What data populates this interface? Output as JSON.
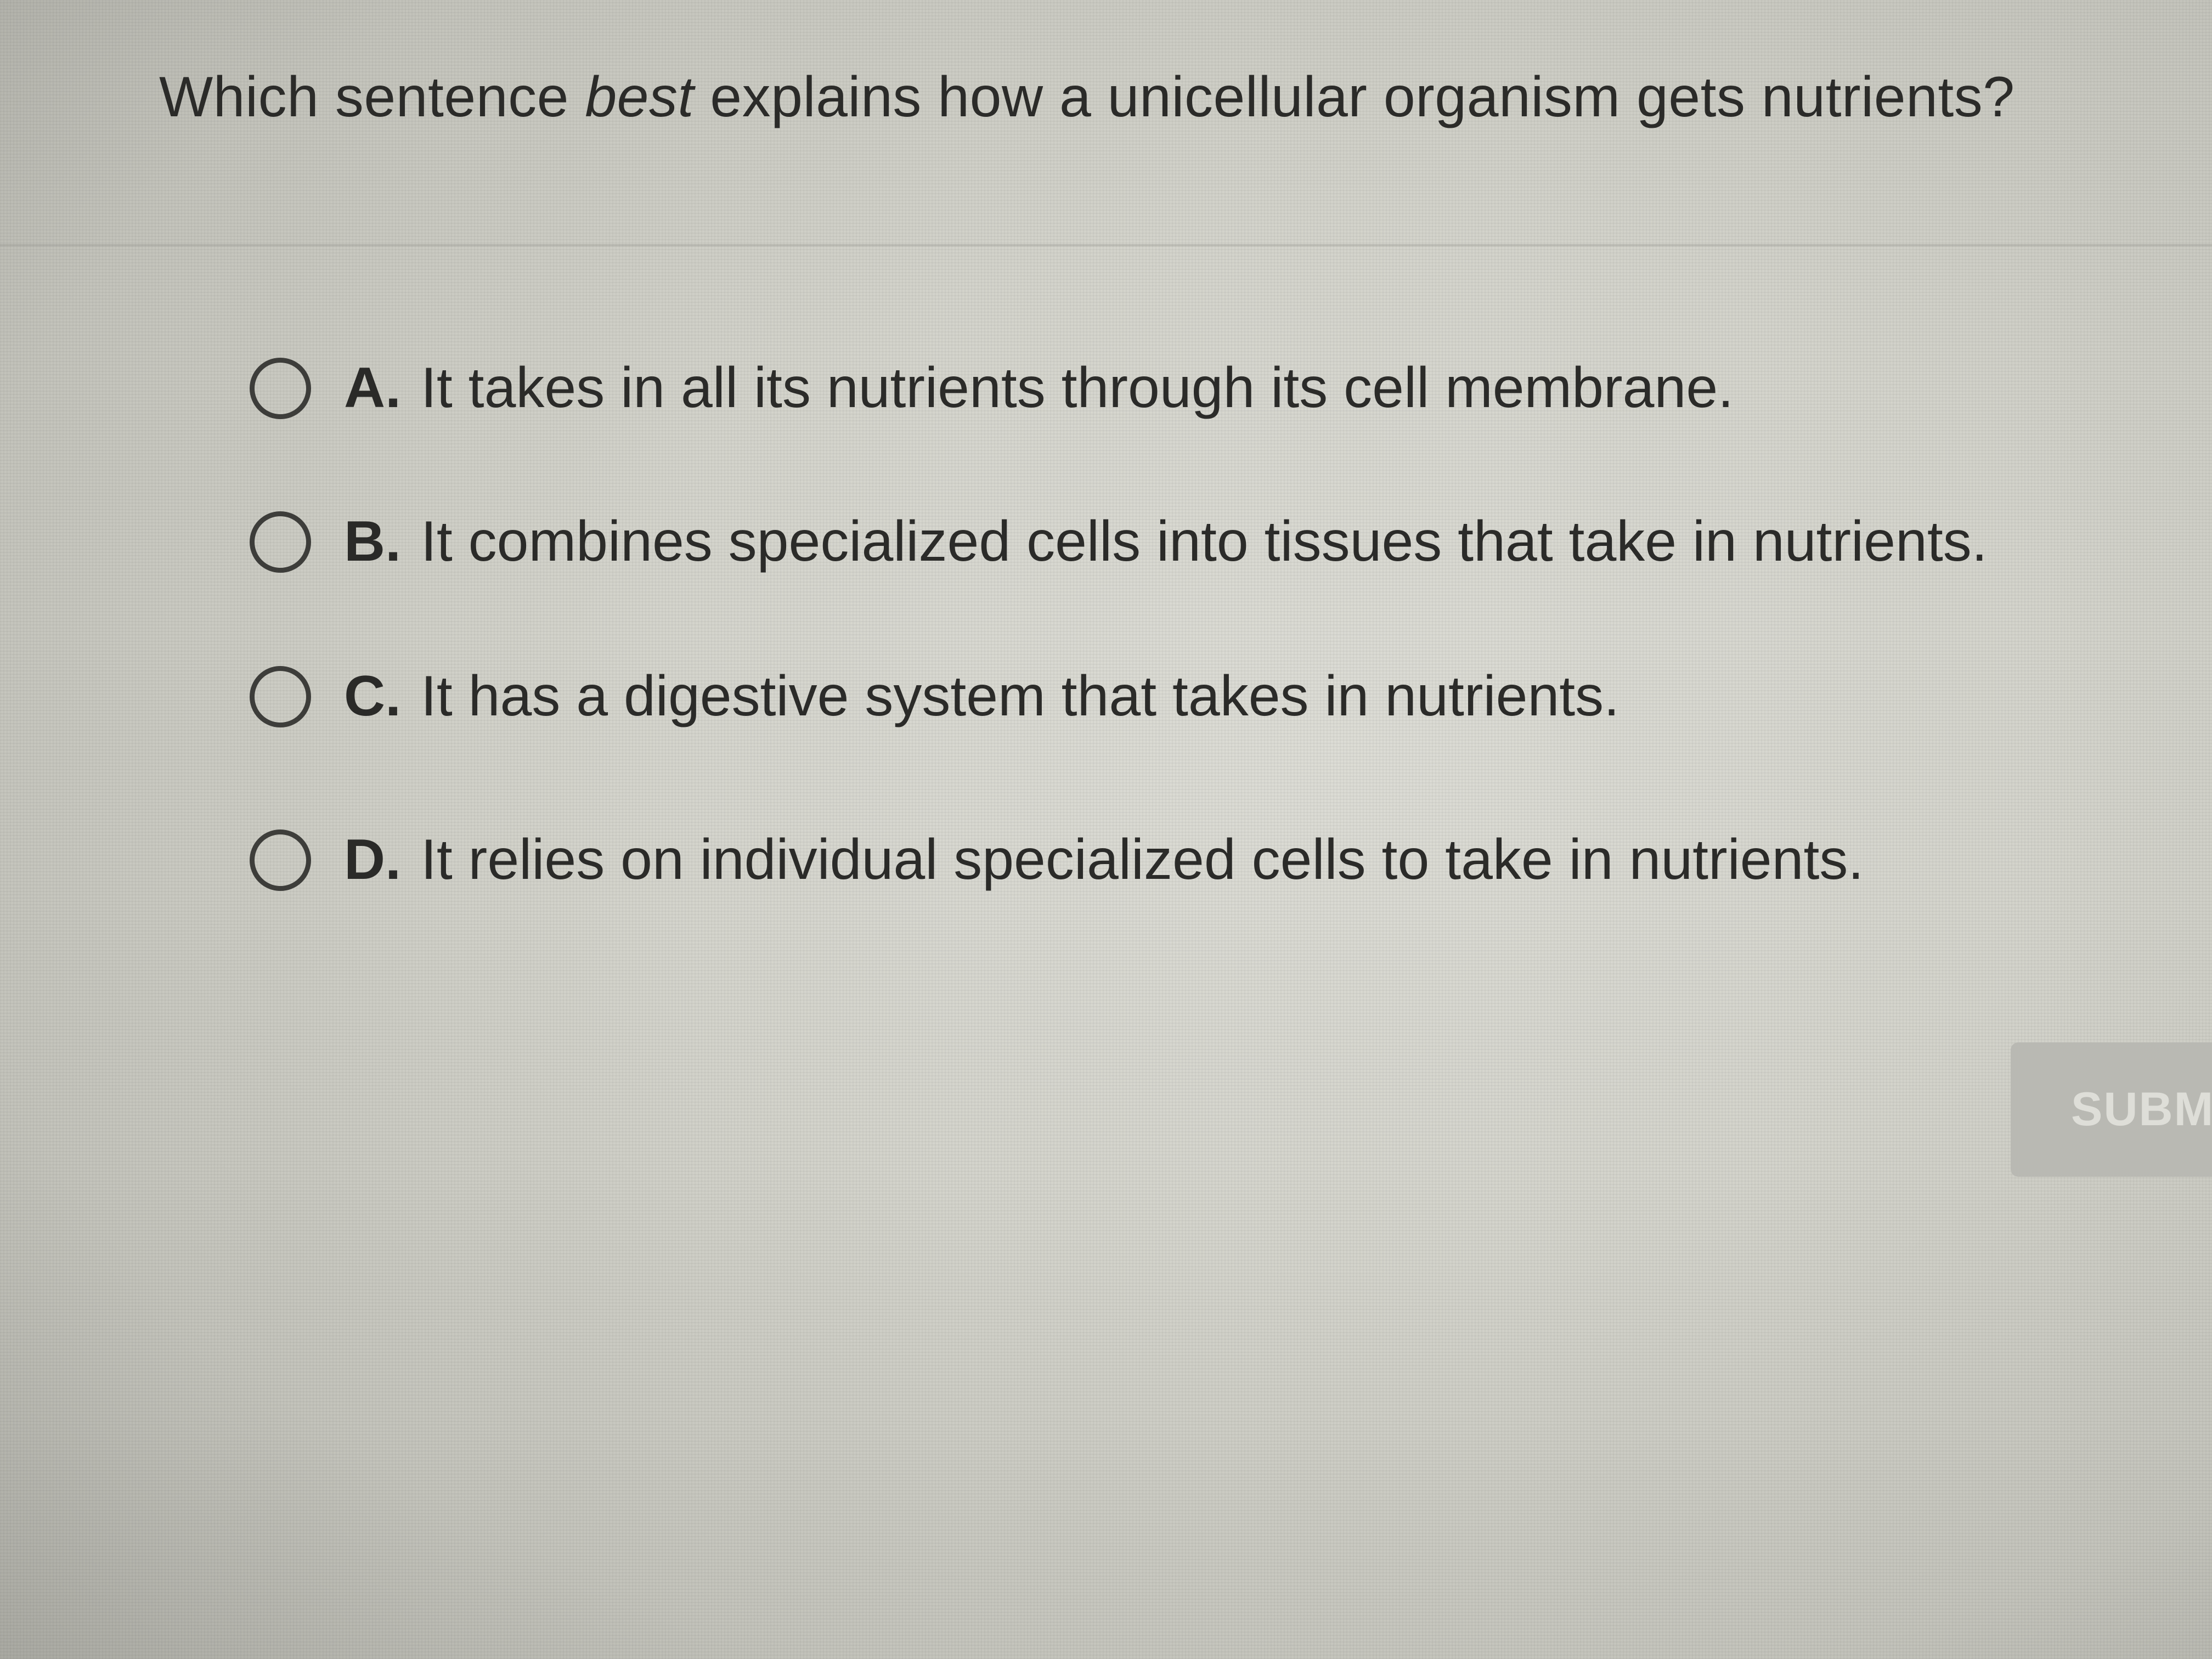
{
  "question": {
    "before": "Which sentence ",
    "emphasis": "best",
    "after": " explains how a unicellular organism gets nutrients?"
  },
  "options": [
    {
      "letter": "A.",
      "text": "It takes in all its nutrients through its cell membrane."
    },
    {
      "letter": "B.",
      "text": "It combines specialized cells into tissues that take in nutrients."
    },
    {
      "letter": "C.",
      "text": "It has a digestive system that takes in nutrients."
    },
    {
      "letter": "D.",
      "text": "It relies on individual specialized cells to take in nutrients."
    }
  ],
  "submit": {
    "label": "SUBMIT"
  }
}
